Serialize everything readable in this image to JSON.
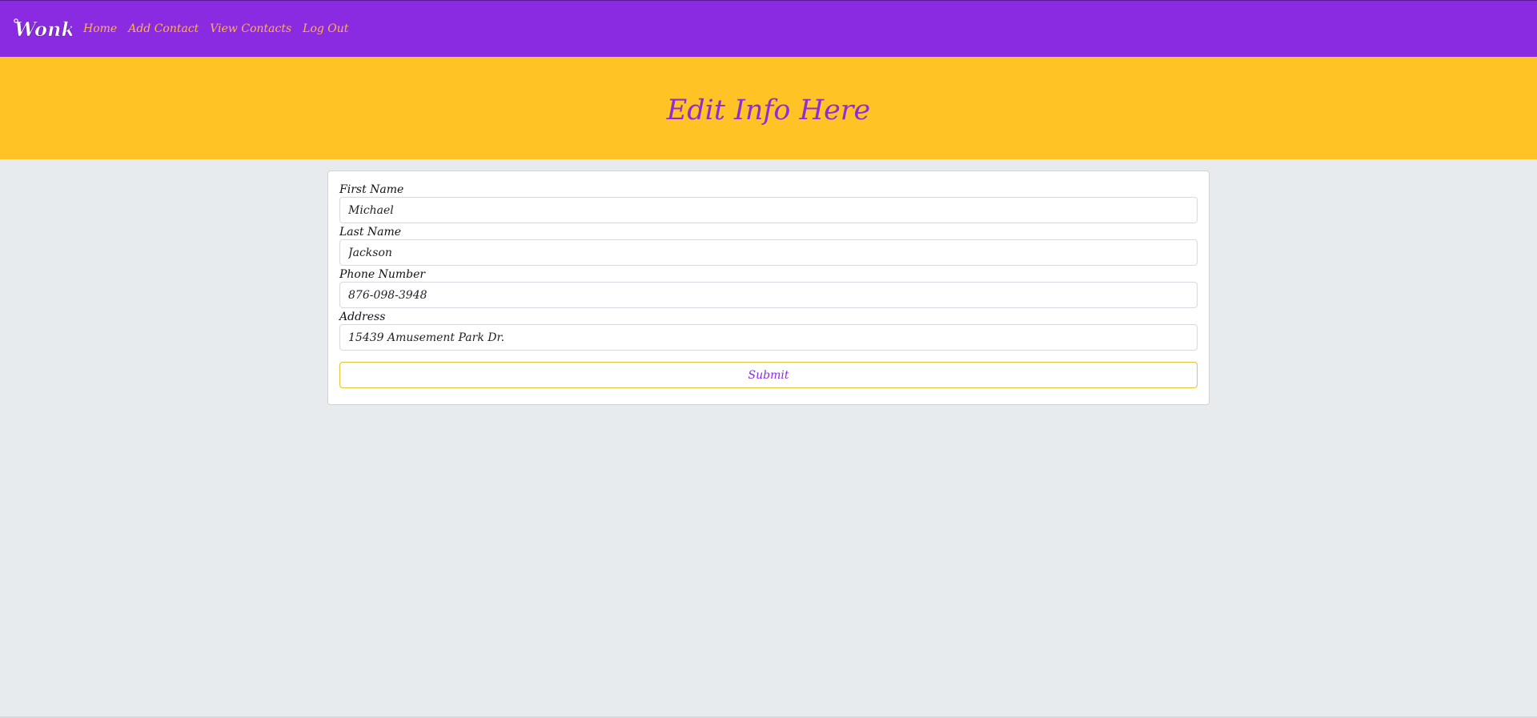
{
  "nav": {
    "logo_text": "Wonka",
    "links": [
      {
        "label": "Home"
      },
      {
        "label": "Add Contact"
      },
      {
        "label": "View Contacts"
      },
      {
        "label": "Log Out"
      }
    ]
  },
  "hero": {
    "title": "Edit Info Here"
  },
  "form": {
    "fields": [
      {
        "label": "First Name",
        "value": "Michael"
      },
      {
        "label": "Last Name",
        "value": "Jackson"
      },
      {
        "label": "Phone Number",
        "value": "876-098-3948"
      },
      {
        "label": "Address",
        "value": "15439 Amusement Park Dr."
      }
    ],
    "submit_label": "Submit"
  },
  "colors": {
    "nav_bg": "#8a2be2",
    "nav_link": "#ffb347",
    "hero_bg": "#ffc325",
    "hero_title": "#8d2ed6",
    "page_bg": "#e8ebee"
  }
}
